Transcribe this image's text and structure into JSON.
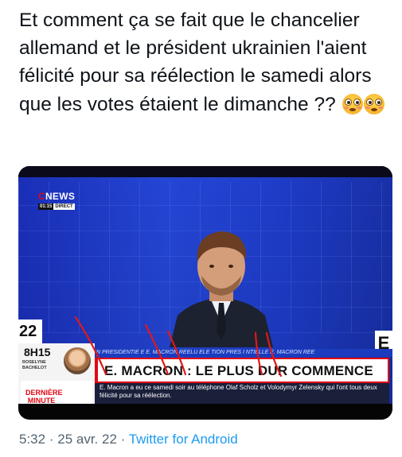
{
  "tweet": {
    "text": "Et comment ça se fait que le chancelier allemand et le président ukrainien l'aient félicité pour sa réélection le samedi alors que les votes étaient le dimanche ??",
    "emoji": [
      "flushed-face-emoji",
      "flushed-face-emoji"
    ]
  },
  "media": {
    "channel": "NEWS",
    "channel_prefix": "C",
    "clock": "01:15",
    "live_label": "DIRECT",
    "left_number": "22",
    "right_letter": "E",
    "show_time": "8H15",
    "anchor_name": "ROSELYNE BACHELOT",
    "banner": "DERNIÈRE MINUTE",
    "ticker": "N PRESIDENTIE  E   E. MACRON REELU    ELE  TION PRES  I  NTIELLE    E. MACRON REE",
    "headline": "E. MACRON : LE PLUS DUR COMMENCE",
    "subtext": "E. Macron a eu ce samedi soir au téléphone Olaf Scholz et Volodymyr Zelensky qui l'ont tous deux félicité pour sa réélection."
  },
  "footer": {
    "time": "5:32",
    "date": "25 avr. 22",
    "source": "Twitter for Android"
  },
  "colors": {
    "brand_red": "#e30613",
    "link_blue": "#1d9bf0",
    "meta_gray": "#536471"
  }
}
